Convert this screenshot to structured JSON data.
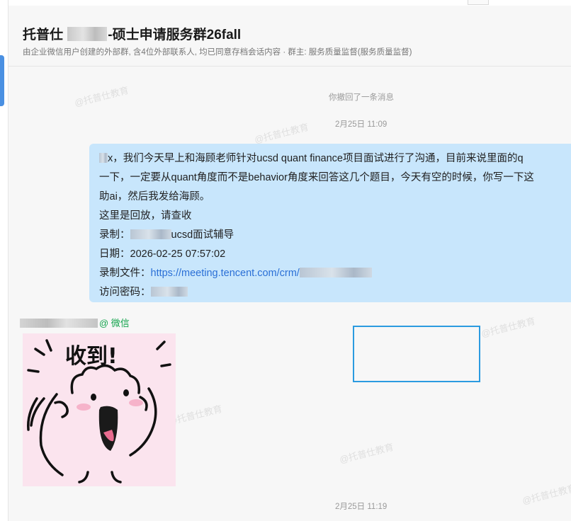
{
  "header": {
    "title_prefix": "托普仕",
    "title_suffix": "-硕士申请服务群26fall",
    "subtitle": "由企业微信用户创建的外部群, 含4位外部联系人, 均已同意存档会话内容 · 群主: 服务质量监督(服务质量监督)"
  },
  "watermark_text": "@托普仕教育",
  "system": {
    "recall_notice": "你撤回了一条消息",
    "time_1": "2月25日 11:09",
    "time_2": "2月25日 11:19"
  },
  "message": {
    "line1": "x，我们今天早上和海顾老师针对ucsd quant finance项目面试进行了沟通，目前来说里面的q",
    "line2": "一下，一定要从quant角度而不是behavior角度来回答这几个题目，今天有空的时候，你写一下这",
    "line3": "助ai，然后我发给海顾。",
    "line4": "这里是回放，请查收",
    "record_label": "录制：",
    "record_value": "ucsd面试辅导",
    "date_label": "日期：",
    "date_value": "2026-02-25 07:57:02",
    "file_label": "录制文件：",
    "file_link": "https://meeting.tencent.com/crm/",
    "password_label": "访问密码："
  },
  "sender": {
    "suffix": "@ 微信"
  },
  "sticker": {
    "text": "收到!"
  }
}
